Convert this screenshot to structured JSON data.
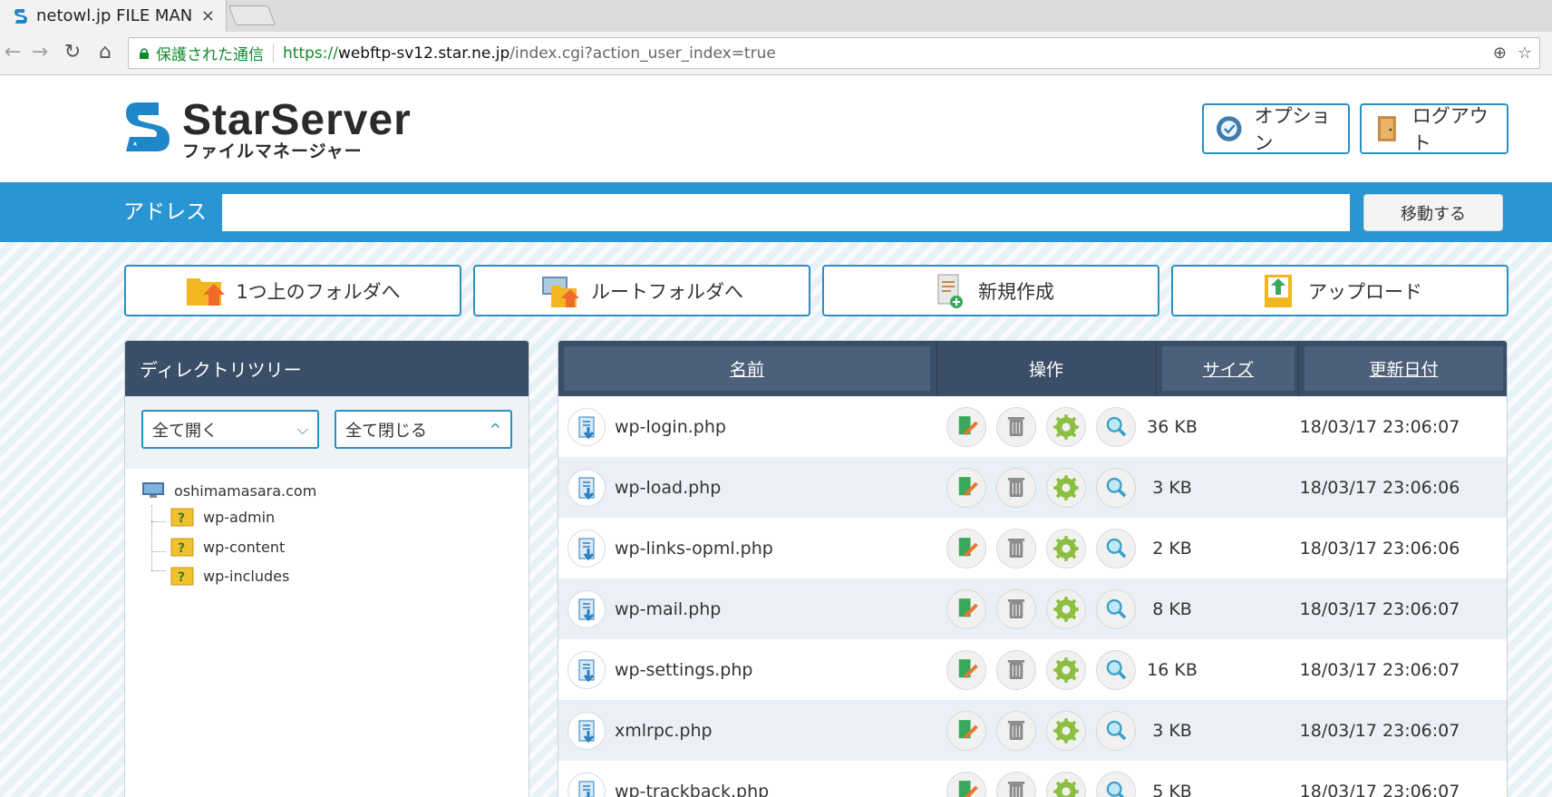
{
  "browser": {
    "tab_title": "netowl.jp FILE MAN",
    "security_label": "保護された通信",
    "url_scheme": "https://",
    "url_host": "webftp-sv12.star.ne.jp",
    "url_path": "/index.cgi?action_user_index=true"
  },
  "header": {
    "logo_main": "StarServer",
    "logo_sub": "ファイルマネージャー",
    "options_label": "オプション",
    "logout_label": "ログアウト"
  },
  "address": {
    "label": "アドレス",
    "value": "",
    "go_label": "移動する"
  },
  "actions": {
    "up_label": "1つ上のフォルダへ",
    "root_label": "ルートフォルダへ",
    "new_label": "新規作成",
    "upload_label": "アップロード"
  },
  "tree": {
    "title": "ディレクトリツリー",
    "expand_all": "全て開く",
    "collapse_all": "全て閉じる",
    "root": "oshimamasara.com",
    "children": [
      "wp-admin",
      "wp-content",
      "wp-includes"
    ]
  },
  "files": {
    "col_name": "名前",
    "col_ops": "操作",
    "col_size": "サイズ",
    "col_date": "更新日付",
    "rows": [
      {
        "name": "wp-login.php",
        "size": "36 KB",
        "date": "18/03/17 23:06:07"
      },
      {
        "name": "wp-load.php",
        "size": "3 KB",
        "date": "18/03/17 23:06:06"
      },
      {
        "name": "wp-links-opml.php",
        "size": "2 KB",
        "date": "18/03/17 23:06:06"
      },
      {
        "name": "wp-mail.php",
        "size": "8 KB",
        "date": "18/03/17 23:06:07"
      },
      {
        "name": "wp-settings.php",
        "size": "16 KB",
        "date": "18/03/17 23:06:07"
      },
      {
        "name": "xmlrpc.php",
        "size": "3 KB",
        "date": "18/03/17 23:06:07"
      },
      {
        "name": "wp-trackback.php",
        "size": "5 KB",
        "date": "18/03/17 23:06:07"
      }
    ]
  },
  "icons": {
    "brand_blue": "#2a95d3",
    "header_dark": "#3b4e67",
    "secure_green": "#118a2e"
  }
}
